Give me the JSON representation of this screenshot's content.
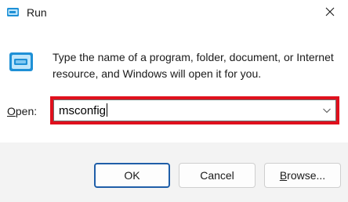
{
  "window": {
    "title": "Run",
    "app_icon": "run-app-icon",
    "close_icon": "close-icon"
  },
  "content": {
    "icon": "run-dialog-icon",
    "description": "Type the name of a program, folder, document, or Internet resource, and Windows will open it for you.",
    "open_label_accel": "O",
    "open_label_rest": "pen:",
    "input_value": "msconfig",
    "dropdown_icon": "chevron-down-icon",
    "highlight_color": "#e0101d"
  },
  "footer": {
    "ok_label": "OK",
    "cancel_label": "Cancel",
    "browse_accel": "B",
    "browse_rest": "rowse..."
  }
}
